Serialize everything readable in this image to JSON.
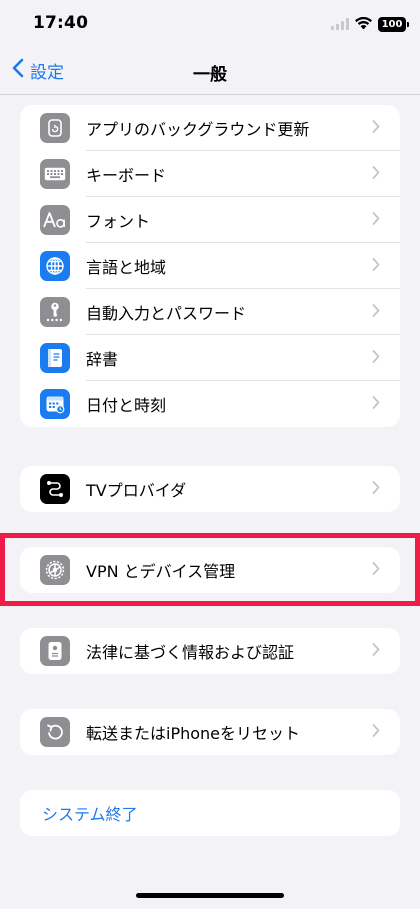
{
  "status_bar": {
    "time": "17:40",
    "battery": "100"
  },
  "nav": {
    "back_label": "設定",
    "title": "一般"
  },
  "groups": {
    "main": [
      {
        "label": "アプリのバックグラウンド更新",
        "icon": "background-refresh-icon"
      },
      {
        "label": "キーボード",
        "icon": "keyboard-icon"
      },
      {
        "label": "フォント",
        "icon": "font-icon"
      },
      {
        "label": "言語と地域",
        "icon": "globe-icon"
      },
      {
        "label": "自動入力とパスワード",
        "icon": "key-icon"
      },
      {
        "label": "辞書",
        "icon": "dictionary-icon"
      },
      {
        "label": "日付と時刻",
        "icon": "calendar-icon"
      }
    ],
    "tv": {
      "label": "TVプロバイダ",
      "icon": "tv-provider-icon"
    },
    "vpn": {
      "label": "VPN とデバイス管理",
      "icon": "gear-icon"
    },
    "legal": {
      "label": "法律に基づく情報および認証",
      "icon": "legal-document-icon"
    },
    "reset": {
      "label": "転送またはiPhoneをリセット",
      "icon": "reset-icon"
    },
    "shutdown": {
      "label": "システム終了"
    }
  },
  "colors": {
    "accent": "#1c7aee",
    "highlight": "#ee1c47",
    "icon_gray": "#8e8e93",
    "icon_blue": "#1a7cf0"
  }
}
